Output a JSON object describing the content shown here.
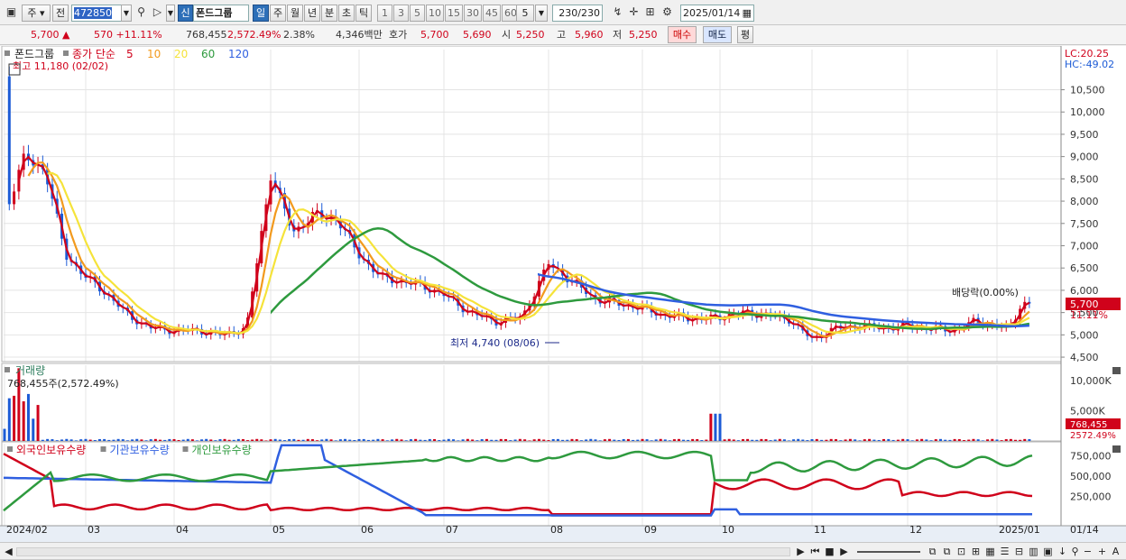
{
  "toolbar": {
    "mode_day": "주",
    "mode_prev": "전",
    "code": "472850",
    "new_badge": "신",
    "stock_name": "폰드그룹",
    "periods": [
      "일",
      "주",
      "월",
      "년",
      "분",
      "초",
      "틱"
    ],
    "active_period": "일",
    "intervals": [
      "1",
      "3",
      "5",
      "10",
      "15",
      "30",
      "45",
      "60"
    ],
    "interval_value": "5",
    "count": "230/230",
    "date": "2025/01/14"
  },
  "quote": {
    "price": "5,700",
    "change": "570",
    "change_pct": "+11.11%",
    "volume": "768,455",
    "volume_pct": "2,572.49%",
    "turnover_pct": "2.38%",
    "amount": "4,346백만",
    "ask_label": "호가",
    "ask1": "5,700",
    "ask2": "5,690",
    "open_label": "시",
    "open": "5,250",
    "high_label": "고",
    "high": "5,960",
    "low_label": "저",
    "low": "5,250",
    "buy": "매수",
    "sell": "매도",
    "eval": "평"
  },
  "price_panel": {
    "stock_label": "폰드그룹",
    "ma_label": "종가 단순",
    "ma_periods": [
      "5",
      "10",
      "20",
      "60",
      "120"
    ],
    "ma_colors": [
      "#d0021b",
      "#f29a1e",
      "#f5e33a",
      "#2e9a3e",
      "#2f5fe0"
    ],
    "max_note": "최고 11,180 (02/02)",
    "min_note": "최저 4,740 (08/06)",
    "div_note": "배당락(0.00%)",
    "lc": "LC:20.25",
    "hc": "HC:-49.02",
    "last_price": "5,700",
    "last_pct": "11.11%",
    "y_ticks": [
      "10,500",
      "10,000",
      "9,500",
      "9,000",
      "8,500",
      "8,000",
      "7,500",
      "7,000",
      "6,500",
      "6,000",
      "5,500",
      "5,000",
      "4,500"
    ]
  },
  "volume_panel": {
    "title": "거래량",
    "note": "768,455주(2,572.49%)",
    "y_ticks": [
      "10,000K",
      "5,000K"
    ],
    "last_volume": "768,455",
    "last_pct": "2572.49%"
  },
  "holding_panel": {
    "legend": [
      "외국인보유수량",
      "기관보유수량",
      "개인보유수량"
    ],
    "colors": [
      "#d0021b",
      "#2f5fe0",
      "#2e9a3e"
    ],
    "y_ticks": [
      "750,000",
      "500,000",
      "250,000"
    ]
  },
  "x_axis": {
    "labels": [
      "2024/02",
      "03",
      "04",
      "05",
      "06",
      "07",
      "08",
      "09",
      "10",
      "11",
      "12",
      "2025/01"
    ],
    "right_label": "01/14"
  },
  "chart_data": {
    "type": "candlestick",
    "price_range": [
      4400,
      11400
    ],
    "closes_by_month": {
      "2024/02": [
        8600,
        7300,
        7700,
        7600
      ],
      "03": [
        6800,
        6300,
        6200,
        6100
      ],
      "04": [
        5900,
        5500,
        5300,
        5400
      ],
      "05": [
        6600,
        6200,
        5800,
        5700
      ],
      "06": [
        5600,
        5450,
        5400,
        5350
      ],
      "07": [
        5400,
        5500,
        5450,
        5350
      ],
      "08": [
        4900,
        5150,
        5200,
        5150
      ],
      "09": [
        5200,
        5150,
        5100,
        5300
      ],
      "10": [
        7700,
        9000,
        8700,
        6800
      ],
      "11": [
        6300,
        5900,
        5400,
        5150
      ],
      "12": [
        5100,
        5100,
        5000,
        5150
      ],
      "2025/01": [
        5200,
        5150,
        5700
      ]
    },
    "volume_unit": "K",
    "volume_range": [
      0,
      12500
    ]
  }
}
